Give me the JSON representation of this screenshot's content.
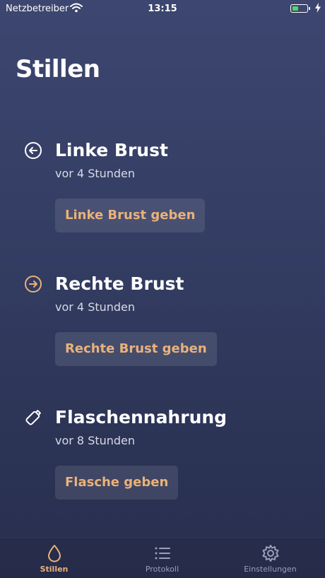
{
  "status_bar": {
    "carrier": "Netzbetreiber",
    "time": "13:15",
    "battery_color": "#4cd964"
  },
  "page": {
    "title": "Stillen"
  },
  "sections": [
    {
      "icon": "arrow-left-circle-icon",
      "title": "Linke Brust",
      "subtitle": "vor 4 Stunden",
      "button": "Linke Brust geben"
    },
    {
      "icon": "arrow-right-circle-icon",
      "title": "Rechte Brust",
      "subtitle": "vor 4 Stunden",
      "button": "Rechte Brust geben"
    },
    {
      "icon": "bottle-icon",
      "title": "Flaschennahrung",
      "subtitle": "vor 8 Stunden",
      "button": "Flasche geben"
    }
  ],
  "tab_bar": {
    "tabs": [
      {
        "label": "Stillen",
        "icon": "drop-icon",
        "active": true
      },
      {
        "label": "Protokoll",
        "icon": "list-icon",
        "active": false
      },
      {
        "label": "Einstellungen",
        "icon": "gear-icon",
        "active": false
      }
    ]
  },
  "colors": {
    "accent": "#e9b27a",
    "background_top": "#3d4670",
    "background_bottom": "#272e4d",
    "inactive_tab": "#9aa0b8"
  }
}
